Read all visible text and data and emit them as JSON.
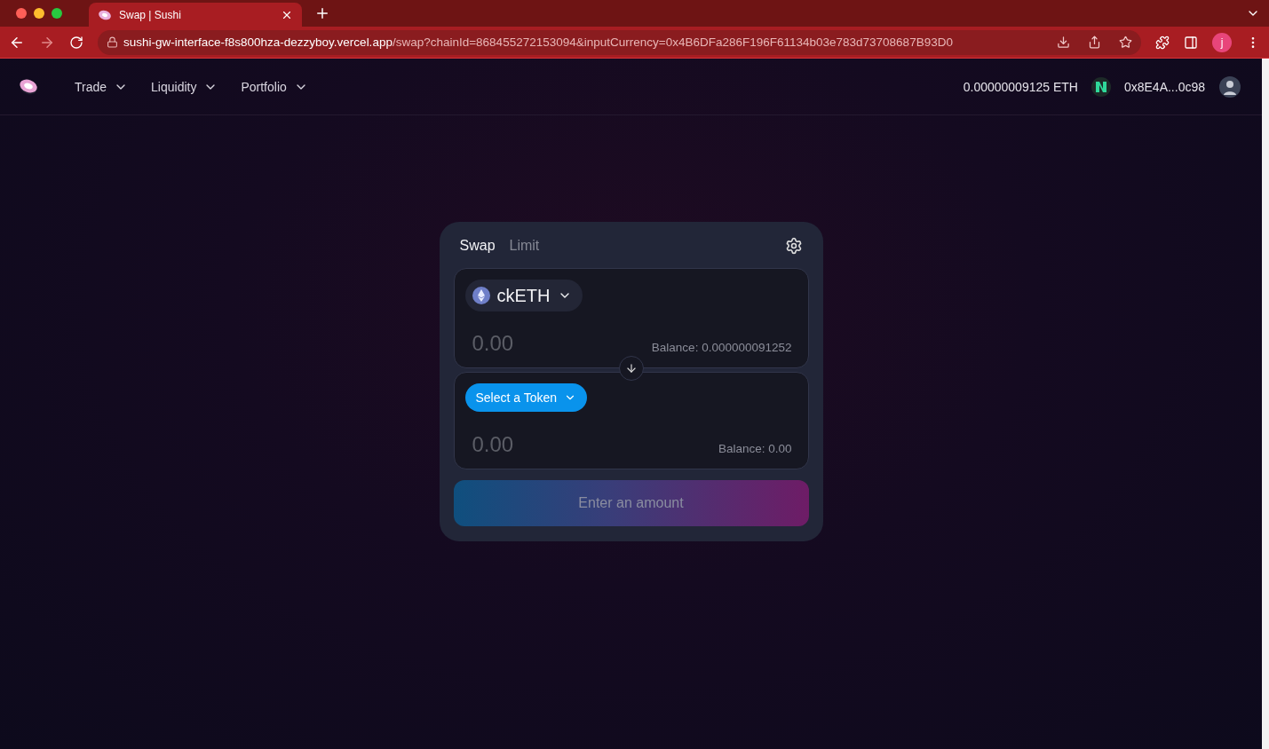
{
  "browser": {
    "tab_title": "Swap | Sushi",
    "url_host": "sushi-gw-interface-f8s800hza-dezzyboy.vercel.app",
    "url_path": "/swap?chainId=868455272153094&inputCurrency=0x4B6DFa286F196F61134b03e783d73708687B93D0",
    "profile_initial": "j"
  },
  "nav": {
    "items": [
      {
        "label": "Trade"
      },
      {
        "label": "Liquidity"
      },
      {
        "label": "Portfolio"
      }
    ],
    "balance": "0.00000009125 ETH",
    "address": "0x8E4A...0c98"
  },
  "swap": {
    "tabs": [
      {
        "label": "Swap",
        "selected": true
      },
      {
        "label": "Limit",
        "selected": false
      }
    ],
    "panels": [
      {
        "token": {
          "kind": "token",
          "label": "ckETH"
        },
        "placeholder": "0.00",
        "balance": "Balance: 0.000000091252"
      },
      {
        "token": {
          "kind": "select",
          "label": "Select a Token"
        },
        "placeholder": "0.00",
        "balance": "Balance: 0.00"
      }
    ],
    "action": {
      "label": "Enter an amount",
      "disabled": true
    }
  }
}
